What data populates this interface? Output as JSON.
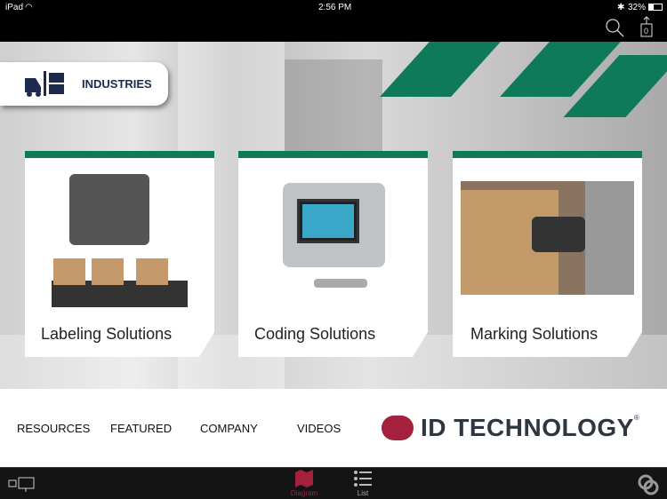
{
  "status": {
    "device": "iPad",
    "time": "2:56 PM",
    "battery": "32%"
  },
  "toolbar": {
    "cart_count": "0"
  },
  "industries": {
    "label": "INDUSTRIES"
  },
  "cards": [
    {
      "title": "Labeling Solutions"
    },
    {
      "title": "Coding Solutions"
    },
    {
      "title": "Marking Solutions"
    }
  ],
  "nav": {
    "items": [
      "RESOURCES",
      "FEATURED",
      "COMPANY",
      "VIDEOS"
    ]
  },
  "brand": {
    "name": "ID TECHNOLOGY",
    "mark": "®"
  },
  "tabs": [
    {
      "label": "Diagram"
    },
    {
      "label": "List"
    }
  ],
  "colors": {
    "green": "#0f7a5a",
    "brand_red": "#a3213c",
    "navy": "#1d2a4d"
  }
}
